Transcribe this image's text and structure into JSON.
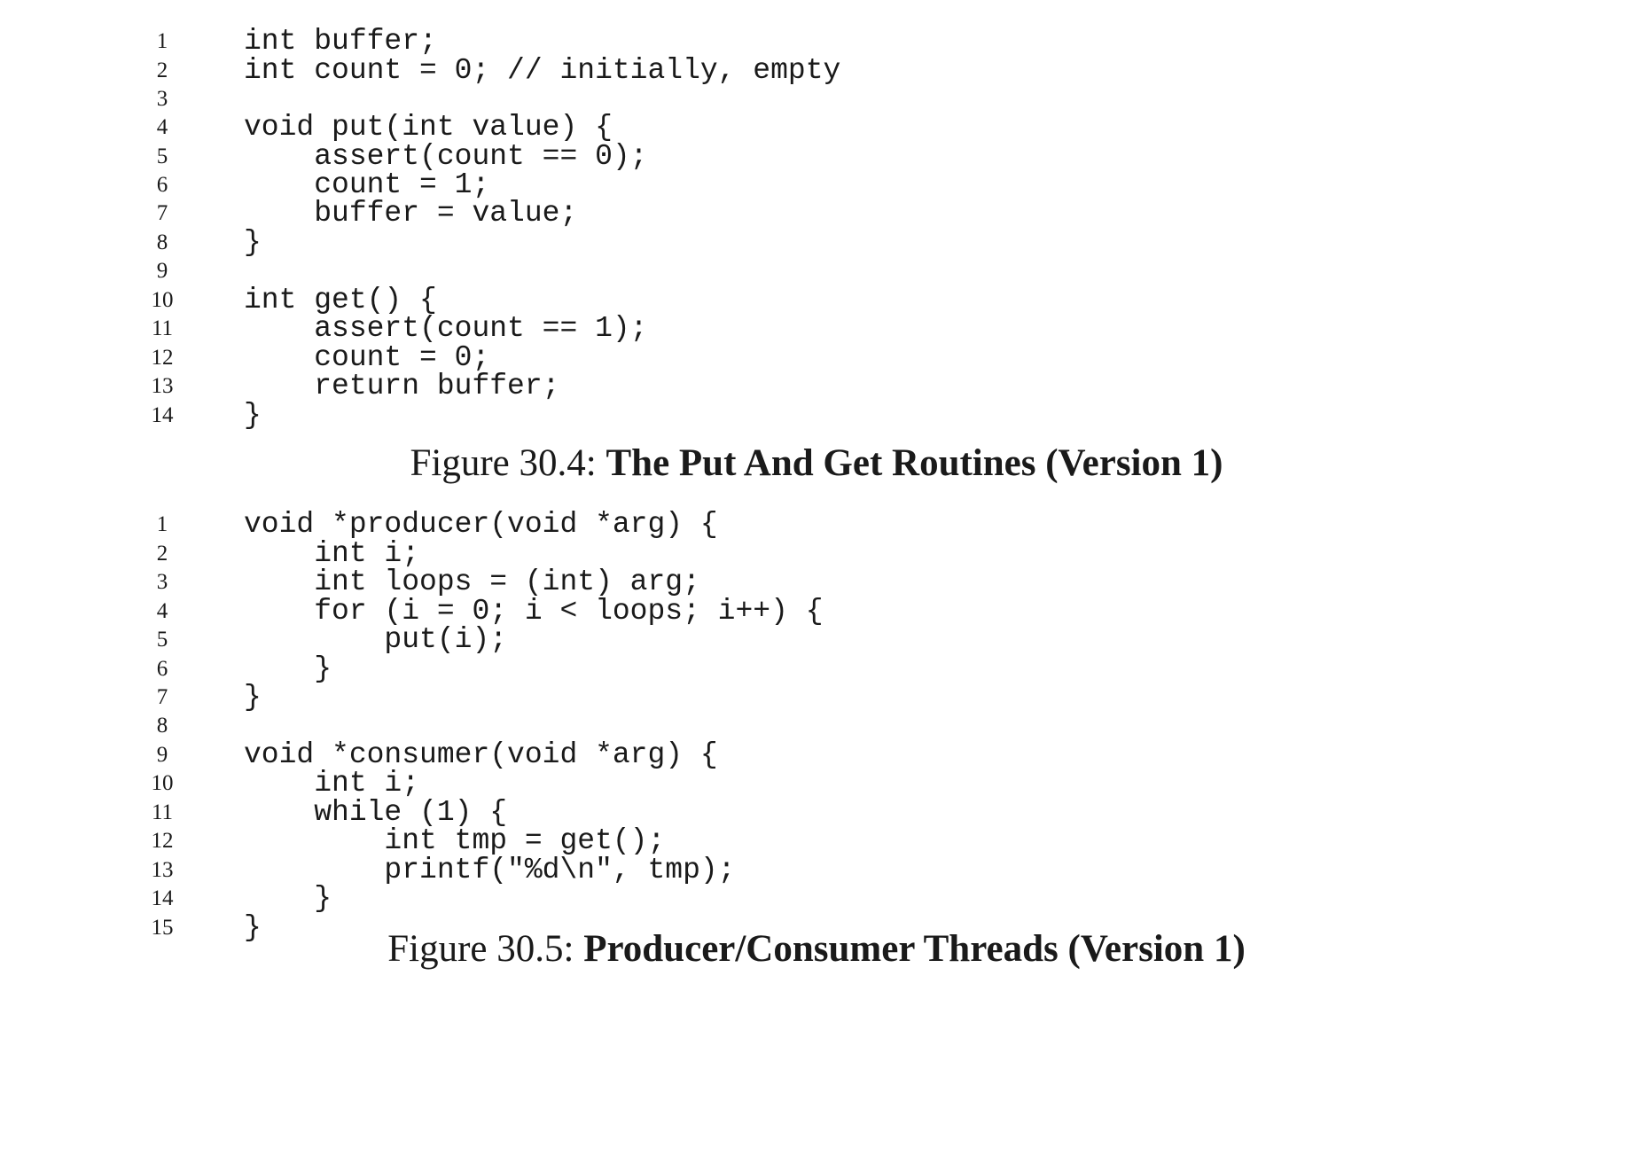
{
  "figure_30_4": {
    "lines": [
      {
        "num": "1",
        "code": "int buffer;"
      },
      {
        "num": "2",
        "code": "int count = 0; // initially, empty"
      },
      {
        "num": "3",
        "code": ""
      },
      {
        "num": "4",
        "code": "void put(int value) {"
      },
      {
        "num": "5",
        "code": "    assert(count == 0);"
      },
      {
        "num": "6",
        "code": "    count = 1;"
      },
      {
        "num": "7",
        "code": "    buffer = value;"
      },
      {
        "num": "8",
        "code": "}"
      },
      {
        "num": "9",
        "code": ""
      },
      {
        "num": "10",
        "code": "int get() {"
      },
      {
        "num": "11",
        "code": "    assert(count == 1);"
      },
      {
        "num": "12",
        "code": "    count = 0;"
      },
      {
        "num": "13",
        "code": "    return buffer;"
      },
      {
        "num": "14",
        "code": "}"
      }
    ],
    "caption_label": "Figure 30.4: ",
    "caption_title": "The Put And Get Routines (Version 1)"
  },
  "figure_30_5": {
    "lines": [
      {
        "num": "1",
        "code": "void *producer(void *arg) {"
      },
      {
        "num": "2",
        "code": "    int i;"
      },
      {
        "num": "3",
        "code": "    int loops = (int) arg;"
      },
      {
        "num": "4",
        "code": "    for (i = 0; i < loops; i++) {"
      },
      {
        "num": "5",
        "code": "        put(i);"
      },
      {
        "num": "6",
        "code": "    }"
      },
      {
        "num": "7",
        "code": "}"
      },
      {
        "num": "8",
        "code": ""
      },
      {
        "num": "9",
        "code": "void *consumer(void *arg) {"
      },
      {
        "num": "10",
        "code": "    int i;"
      },
      {
        "num": "11",
        "code": "    while (1) {"
      },
      {
        "num": "12",
        "code": "        int tmp = get();"
      },
      {
        "num": "13",
        "code": "        printf(\"%d\\n\", tmp);"
      },
      {
        "num": "14",
        "code": "    }"
      },
      {
        "num": "15",
        "code": "}"
      }
    ],
    "caption_label": "Figure 30.5: ",
    "caption_title": "Producer/Consumer Threads (Version 1)"
  }
}
